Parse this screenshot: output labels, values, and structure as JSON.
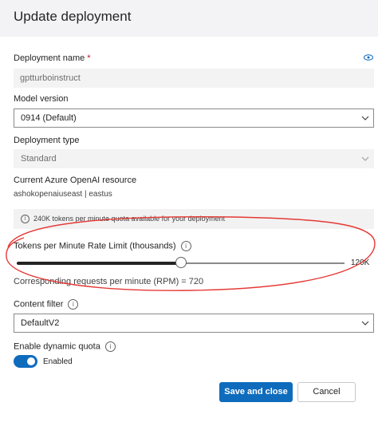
{
  "dialog": {
    "title": "Update deployment"
  },
  "deployment_name": {
    "label": "Deployment name",
    "required_mark": "*",
    "value": "gptturboinstruct"
  },
  "model_version": {
    "label": "Model version",
    "value": "0914 (Default)"
  },
  "deployment_type": {
    "label": "Deployment type",
    "value": "Standard"
  },
  "resource": {
    "label": "Current Azure OpenAI resource",
    "value": "ashokopenaiuseast | eastus"
  },
  "quota_banner": {
    "text": "240K tokens per minute quota available for your deployment"
  },
  "rate_limit": {
    "label": "Tokens per Minute Rate Limit (thousands)",
    "value_label": "120K",
    "slider_fraction": 0.5,
    "rpm_text": "Corresponding requests per minute (RPM) = 720"
  },
  "content_filter": {
    "label": "Content filter",
    "value": "DefaultV2"
  },
  "dynamic_quota": {
    "label": "Enable dynamic quota",
    "toggle_state": "Enabled",
    "on": true
  },
  "buttons": {
    "save": "Save and close",
    "cancel": "Cancel"
  },
  "colors": {
    "accent": "#0f6cbd",
    "annotation": "#e53935"
  },
  "icons": {
    "info": "info-icon",
    "view": "eye-icon",
    "chevron": "chevron-down-icon"
  }
}
